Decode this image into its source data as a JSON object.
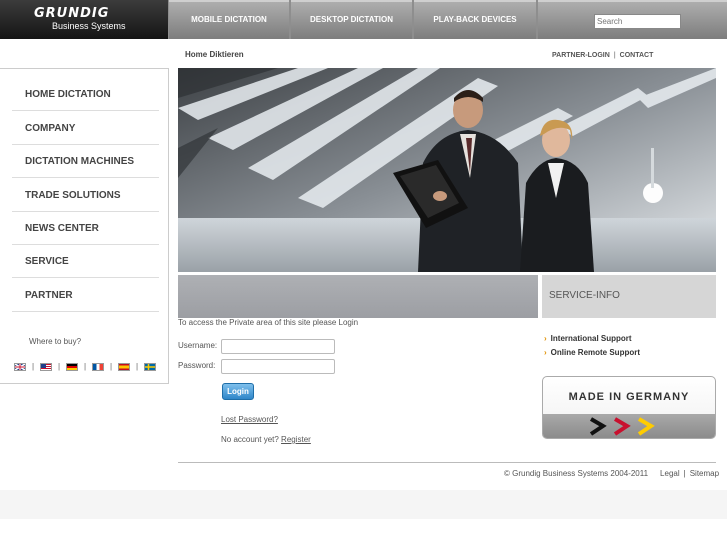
{
  "brand": {
    "name": "GRUNDIG",
    "sub": "Business Systems"
  },
  "nav": {
    "tabs": [
      "MOBILE DICTATION",
      "DESKTOP DICTATION",
      "PLAY-BACK DEVICES"
    ],
    "search_placeholder": "Search"
  },
  "breadcrumb": "Home Diktieren",
  "toplinks": {
    "partner_login": "PARTNER-LOGIN",
    "separator": "|",
    "contact": "CONTACT"
  },
  "sidebar": {
    "items": [
      "HOME DICTATION",
      "COMPANY",
      "DICTATION MACHINES",
      "TRADE SOLUTIONS",
      "NEWS CENTER",
      "SERVICE",
      "PARTNER"
    ],
    "where_to_buy": "Where to buy?",
    "flag_separator": "|",
    "flags": [
      "flag-uk-icon",
      "flag-us-icon",
      "flag-germany-icon",
      "flag-france-icon",
      "flag-spain-icon",
      "flag-sweden-icon"
    ]
  },
  "login": {
    "intro": "To access the Private area of this site please Login",
    "username_label": "Username:",
    "password_label": "Password:",
    "button": "Login",
    "lost_password": "Lost Password?",
    "no_account": "No account yet?",
    "register": "Register"
  },
  "service": {
    "title": "SERVICE-INFO",
    "links": [
      "International Support",
      "Online Remote Support"
    ]
  },
  "made_in_germany": "MADE IN GERMANY",
  "footer": {
    "copyright": "© Grundig Business Systems 2004-2011",
    "legal": "Legal",
    "separator": "|",
    "sitemap": "Sitemap"
  },
  "colors": {
    "accent_orange": "#e09000",
    "button_blue": "#2f86c9",
    "nav_grey": "#8e8e8e"
  }
}
